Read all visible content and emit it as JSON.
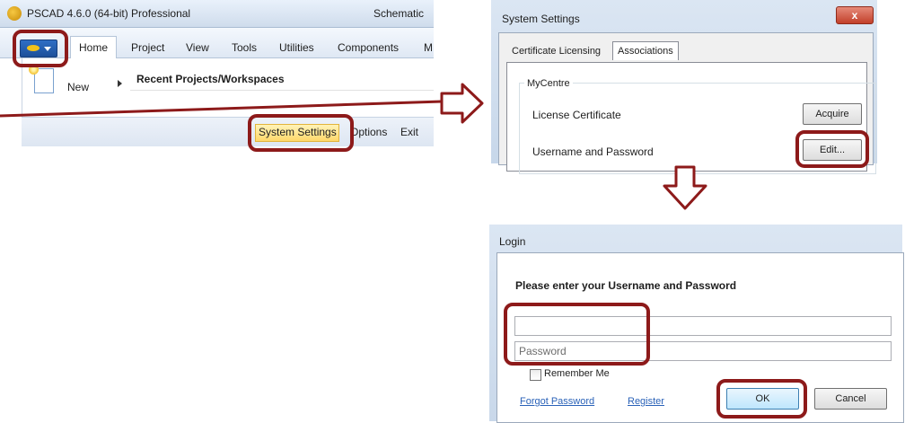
{
  "pscad": {
    "title": "PSCAD 4.6.0 (64-bit) Professional",
    "mode": "Schematic",
    "tabs": [
      "Home",
      "Project",
      "View",
      "Tools",
      "Utilities",
      "Components",
      "M"
    ],
    "new_label": "New",
    "recent_title": "Recent Projects/Workspaces",
    "footer": {
      "system_settings": "System Settings",
      "options": "Options",
      "exit": "Exit"
    }
  },
  "system_settings": {
    "title": "System Settings",
    "close_glyph": "x",
    "tabs": [
      "Certificate Licensing",
      "Associations"
    ],
    "group_title": "MyCentre",
    "license_label": "License Certificate",
    "acquire_label": "Acquire",
    "userpass_label": "Username and Password",
    "edit_label": "Edit..."
  },
  "login": {
    "title": "Login",
    "heading": "Please enter your Username and Password",
    "username_value": "",
    "password_placeholder": "Password",
    "remember_label": "Remember Me",
    "forgot_link": "Forgot Password",
    "register_link": "Register",
    "ok_label": "OK",
    "cancel_label": "Cancel"
  },
  "colors": {
    "highlight": "#8d1a1a",
    "ribbon_accent": "#ffd86a",
    "link": "#2a62b8"
  }
}
